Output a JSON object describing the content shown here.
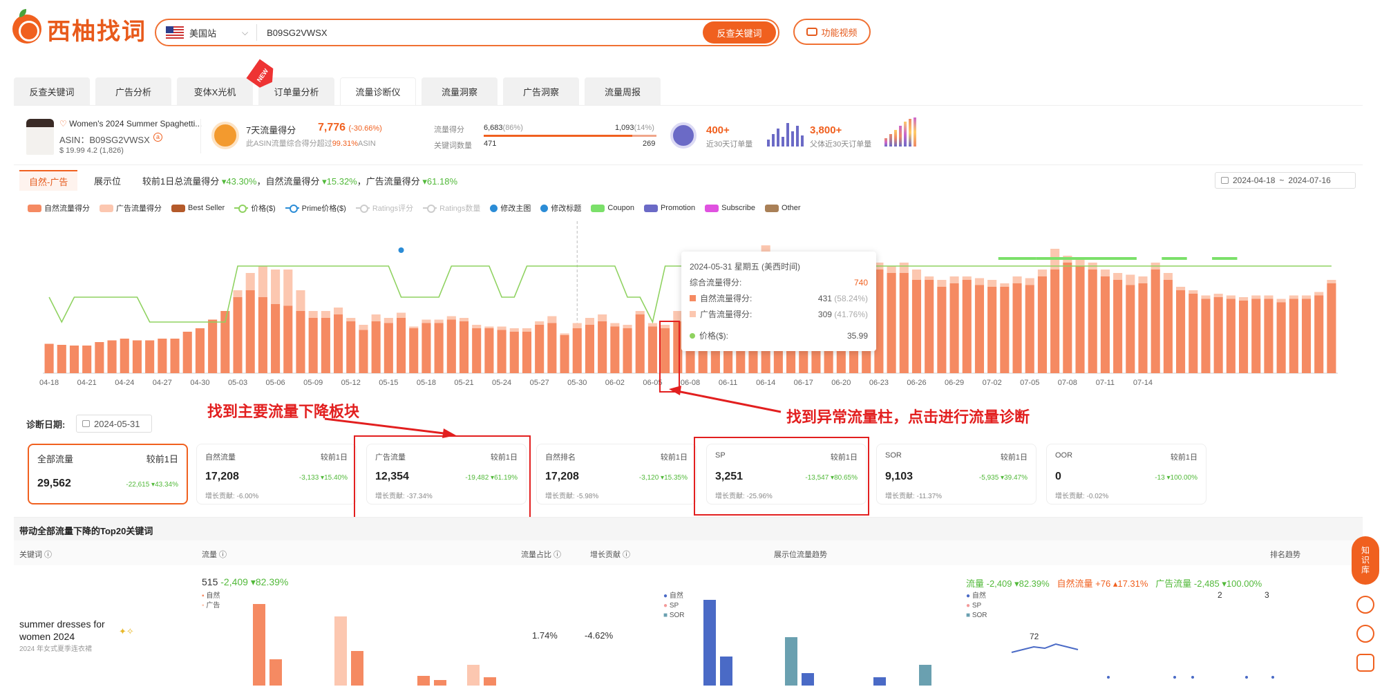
{
  "header": {
    "logo_text": "西柚找词",
    "site": "美国站",
    "search_value": "B09SG2VWSX",
    "search_button": "反查关键词",
    "video_button": "功能视频"
  },
  "tabs": [
    "反查关键词",
    "广告分析",
    "变体X光机",
    "订单量分析",
    "流量诊断仪",
    "流量洞察",
    "广告洞察",
    "流量周报"
  ],
  "active_tab": "流量诊断仪",
  "new_badge": "NEW",
  "product": {
    "title": "Women's 2024 Summer Spaghetti...",
    "asin_label": "ASIN：B09SG2VWSX",
    "price_line": "$ 19.99  4.2  (1,826)"
  },
  "score7": {
    "label": "7天流量得分",
    "value": "7,776",
    "change": "(-30.66%)",
    "sub_prefix": "此ASIN流量综合得分超过",
    "sub_pct": "99.31%",
    "sub_suffix": "ASIN"
  },
  "flow": {
    "label1": "流量得分",
    "label2": "关键词数量",
    "nat_score": "6,683",
    "nat_pct": "(86%)",
    "ad_score": "1,093",
    "ad_pct": "(14%)",
    "nat_kw": "471",
    "ad_kw": "269",
    "nat_share": 0.86
  },
  "orders": {
    "v1": "400+",
    "s1": "近30天订单量",
    "v2": "3,800+",
    "s2": "父体近30天订单量"
  },
  "chart_header": {
    "tab1": "自然-广告",
    "tab2": "展示位",
    "compare_prefix": "较前1日总流量得分",
    "c1": "▾43.30%",
    "mid1": "，自然流量得分",
    "c2": "▾15.32%",
    "mid2": "，广告流量得分",
    "c3": "▾61.18%",
    "date_from": "2024-04-18",
    "date_sep": "~",
    "date_to": "2024-07-16"
  },
  "legend": [
    "自然流量得分",
    "广告流量得分",
    "Best Seller",
    "价格($)",
    "Prime价格($)",
    "Ratings评分",
    "Ratings数量",
    "修改主图",
    "修改标题",
    "Coupon",
    "Promotion",
    "Subscribe",
    "Other"
  ],
  "tooltip": {
    "title": "2024-05-31 星期五 (美西时间)",
    "total_label": "综合流量得分:",
    "total_value": "740",
    "nat_label": "自然流量得分:",
    "nat_value": "431",
    "nat_pct": "(58.24%)",
    "ad_label": "广告流量得分:",
    "ad_value": "309",
    "ad_pct": "(41.76%)",
    "price_label": "价格($):",
    "price_value": "35.99"
  },
  "annotations": {
    "a1": "找到主要流量下降板块",
    "a2": "找到异常流量柱，点击进行流量诊断"
  },
  "diag": {
    "label": "诊断日期:",
    "date": "2024-05-31",
    "cards": [
      {
        "t": "全部流量",
        "cmp": "较前1日",
        "v": "29,562",
        "d": "-22,615 ▾43.34%",
        "c": "",
        "selected": true
      },
      {
        "t": "自然流量",
        "cmp": "较前1日",
        "v": "17,208",
        "d": "-3,133 ▾15.40%",
        "c": "增长贡献: -6.00%"
      },
      {
        "t": "广告流量",
        "cmp": "较前1日",
        "v": "12,354",
        "d": "-19,482 ▾61.19%",
        "c": "增长贡献: -37.34%"
      },
      {
        "t": "自然排名",
        "cmp": "较前1日",
        "v": "17,208",
        "d": "-3,120 ▾15.35%",
        "c": "增长贡献: -5.98%"
      },
      {
        "t": "SP",
        "cmp": "较前1日",
        "v": "3,251",
        "d": "-13,547 ▾80.65%",
        "c": "增长贡献: -25.96%"
      },
      {
        "t": "SOR",
        "cmp": "较前1日",
        "v": "9,103",
        "d": "-5,935 ▾39.47%",
        "c": "增长贡献: -11.37%"
      },
      {
        "t": "OOR",
        "cmp": "较前1日",
        "v": "0",
        "d": "-13 ▾100.00%",
        "c": "增长贡献: -0.02%"
      }
    ]
  },
  "table": {
    "band_title": "带动全部流量下降的Top20关键词",
    "h1": "关键词",
    "h2": "流量",
    "h3": "流量占比",
    "h4": "增长贡献",
    "h5": "展示位流量趋势",
    "h6": "排名趋势",
    "kw": "summer dresses for women 2024",
    "kw_sub": "2024 年女式夏季连衣裙",
    "flow": "515",
    "flow_d": "-2,409",
    "flow_p": "▾82.39%",
    "share": "1.74%",
    "contrib": "-4.62%",
    "m_l1": "自然",
    "m_l2": "广告",
    "m_l3": "SP",
    "m_l4": "SOR",
    "r_flow": "流量 -2,409 ▾82.39%",
    "r_nat": "自然流量 +76 ▴17.31%",
    "r_ad": "广告流量 -2,485 ▾100.00%",
    "r72": "72",
    "r2": "2",
    "r3": "3"
  },
  "side": {
    "zsk": "知识库"
  },
  "colors": {
    "accent": "#f0601f",
    "nat": "#f58a62",
    "ad": "#fcc7b0",
    "price": "#8fd260",
    "promo_green": "#7be06a",
    "blue": "#2b8cd6"
  },
  "chart_data": {
    "type": "bar",
    "xlabels": [
      "04-18",
      "04-21",
      "04-24",
      "04-27",
      "04-30",
      "05-03",
      "05-06",
      "05-09",
      "05-12",
      "05-15",
      "05-18",
      "05-21",
      "05-24",
      "05-27",
      "05-30",
      "06-02",
      "06-05",
      "06-08",
      "06-11",
      "06-14",
      "06-17",
      "06-20",
      "06-23",
      "06-26",
      "06-29",
      "07-02",
      "07-05",
      "07-08",
      "07-11",
      "07-14"
    ],
    "nat": [
      85,
      82,
      80,
      80,
      90,
      95,
      100,
      95,
      95,
      100,
      100,
      120,
      130,
      155,
      180,
      220,
      240,
      220,
      200,
      195,
      180,
      160,
      160,
      170,
      150,
      125,
      150,
      145,
      160,
      130,
      145,
      145,
      155,
      150,
      130,
      130,
      125,
      120,
      120,
      140,
      145,
      110,
      130,
      140,
      150,
      135,
      130,
      170,
      135,
      130,
      150,
      130,
      140,
      170,
      90,
      155,
      230,
      240,
      220,
      235,
      225,
      225,
      290,
      300,
      260,
      260,
      300,
      290,
      290,
      270,
      270,
      250,
      260,
      270,
      255,
      250,
      250,
      260,
      255,
      280,
      300,
      320,
      310,
      300,
      280,
      270,
      255,
      260,
      300,
      270,
      240,
      230,
      215,
      220,
      215,
      210,
      215,
      215,
      205,
      215,
      215,
      225,
      260
    ],
    "ad": [
      0,
      0,
      0,
      0,
      0,
      0,
      0,
      0,
      0,
      0,
      0,
      0,
      0,
      0,
      0,
      20,
      50,
      90,
      100,
      105,
      60,
      20,
      20,
      20,
      10,
      15,
      20,
      15,
      15,
      5,
      10,
      10,
      10,
      10,
      10,
      5,
      10,
      10,
      10,
      10,
      20,
      5,
      15,
      20,
      20,
      10,
      10,
      10,
      10,
      10,
      30,
      20,
      20,
      20,
      30,
      90,
      90,
      130,
      20,
      20,
      20,
      20,
      20,
      15,
      30,
      20,
      20,
      20,
      30,
      30,
      10,
      20,
      20,
      10,
      20,
      20,
      10,
      20,
      20,
      20,
      60,
      20,
      20,
      20,
      20,
      20,
      30,
      20,
      20,
      20,
      10,
      10,
      10,
      10,
      10,
      10,
      10,
      10,
      10,
      10,
      10,
      10,
      10
    ],
    "price": [
      50,
      30,
      50,
      50,
      50,
      50,
      50,
      50,
      30,
      30,
      30,
      30,
      30,
      30,
      30,
      75,
      75,
      75,
      75,
      75,
      75,
      75,
      75,
      75,
      75,
      75,
      75,
      75,
      50,
      50,
      50,
      50,
      75,
      75,
      75,
      75,
      50,
      50,
      75,
      75,
      75,
      75,
      75,
      75,
      75,
      75,
      50,
      50,
      30,
      75,
      75,
      75,
      75,
      75,
      30,
      60,
      75,
      75,
      75,
      75,
      75,
      75,
      75,
      75,
      75,
      75,
      75,
      75,
      75,
      75,
      75,
      75,
      75,
      75,
      75,
      75,
      75,
      75,
      75,
      75,
      75,
      75,
      75,
      75,
      75,
      75,
      75,
      75,
      75,
      75,
      75,
      75,
      75,
      75,
      75,
      75,
      75,
      75,
      75,
      75,
      75,
      75,
      75
    ],
    "ylim": [
      0,
      400
    ]
  }
}
